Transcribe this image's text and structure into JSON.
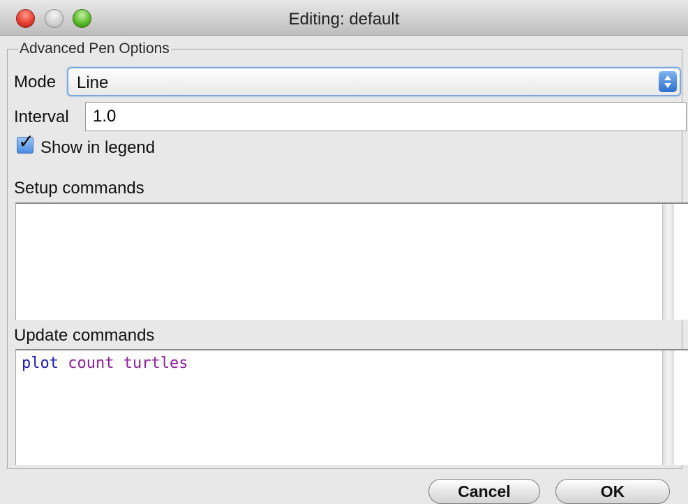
{
  "window": {
    "title": "Editing: default"
  },
  "group": {
    "title": "Advanced Pen Options"
  },
  "mode": {
    "label": "Mode",
    "value": "Line"
  },
  "interval": {
    "label": "Interval",
    "value": "1.0"
  },
  "legend": {
    "label": "Show in legend",
    "checked": true
  },
  "setup": {
    "label": "Setup commands",
    "code": ""
  },
  "update": {
    "label": "Update commands",
    "code_tokens": [
      "plot",
      "count",
      "turtles"
    ]
  },
  "buttons": {
    "cancel": "Cancel",
    "ok": "OK"
  },
  "icons": {
    "close": "close-icon",
    "minimize": "minimize-icon",
    "zoom": "zoom-icon",
    "select_arrows": "up-down-arrows-icon",
    "check": "checkmark-icon"
  },
  "colors": {
    "select_border": "#7da6d9",
    "command_keyword": "#1b1bb0",
    "reporter_keyword": "#8a1f9a"
  }
}
